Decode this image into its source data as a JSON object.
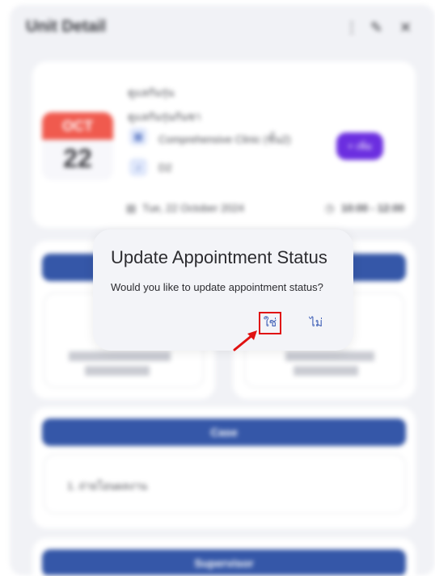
{
  "header": {
    "title": "Unit Detail",
    "icons": [
      "more-vertical-icon",
      "edit-pencil-icon",
      "close-icon"
    ]
  },
  "appointment": {
    "month": "OCT",
    "day": "22",
    "line1": "ดูแลกันรุ่น",
    "line2": "ดูแลกันรุ่นกันชา",
    "clinic": "Comprehensive Clinic (ชั้น2)",
    "room": "D2",
    "date": "Tue, 22 October 2024",
    "time": "10:00 - 12:00",
    "new_button": "+ เพิ่ม"
  },
  "sections": {
    "case_label": "Case",
    "case_item": "1. ถ่ายโอนผลงาน",
    "supervisor_label": "Supervisor"
  },
  "dialog": {
    "title": "Update Appointment Status",
    "message": "Would you like to update appointment status?",
    "yes_label": "ใช่",
    "no_label": "ไม่"
  },
  "colors": {
    "accent_blue": "#3557a8",
    "purple": "#6b2ee0",
    "calendar_red": "#f05a4e",
    "highlight_red": "#e01212"
  }
}
